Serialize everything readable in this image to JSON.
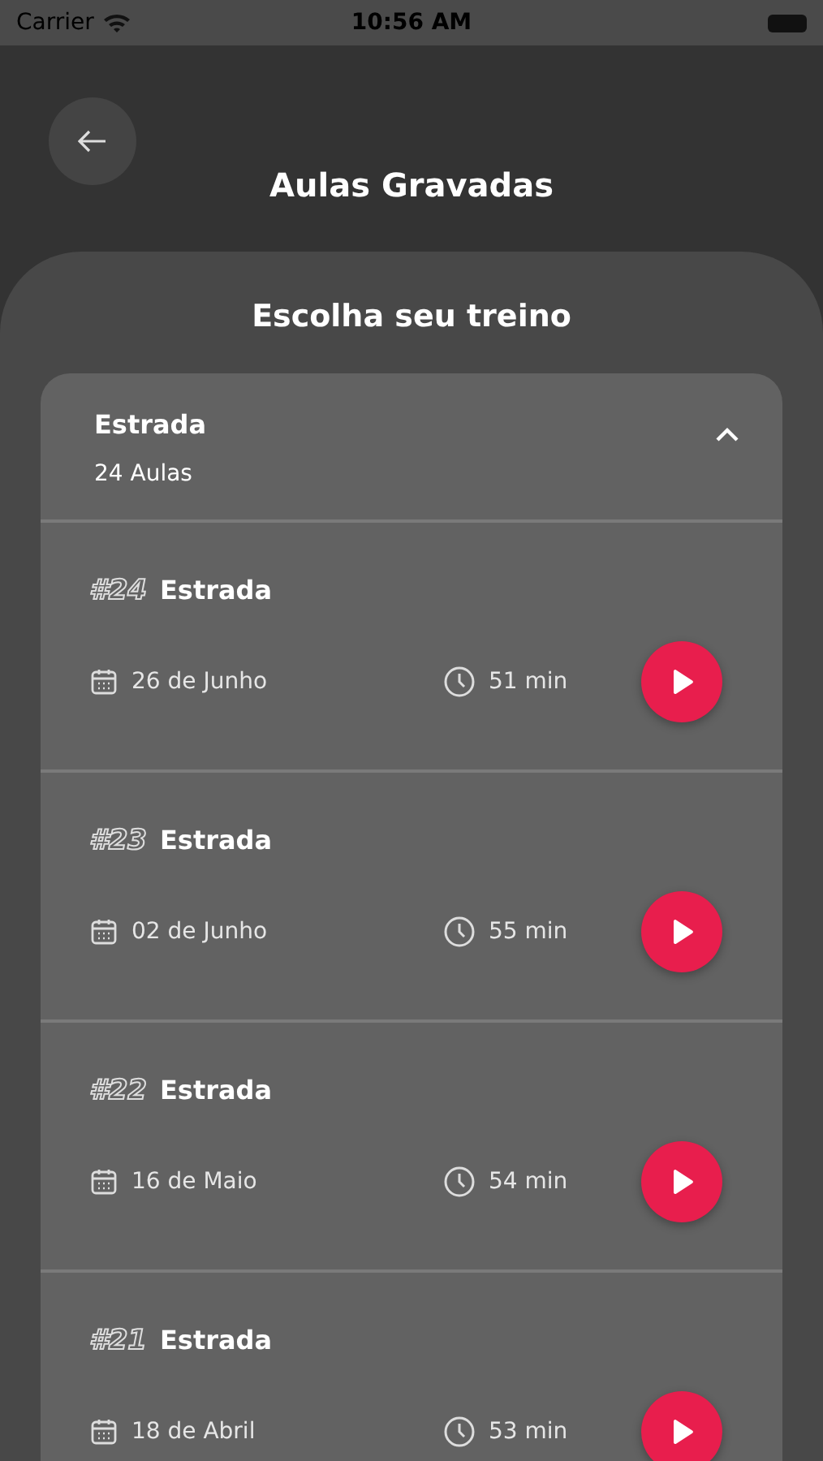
{
  "status_bar": {
    "carrier": "Carrier",
    "time": "10:56 AM"
  },
  "header": {
    "title": "Aulas Gravadas"
  },
  "panel": {
    "title": "Escolha seu treino",
    "group": {
      "title": "Estrada",
      "count": "24 Aulas",
      "expanded": true,
      "lessons": [
        {
          "number": "#24",
          "title": "Estrada",
          "date": "26 de Junho",
          "duration": "51 min"
        },
        {
          "number": "#23",
          "title": "Estrada",
          "date": "02 de Junho",
          "duration": "55 min"
        },
        {
          "number": "#22",
          "title": "Estrada",
          "date": "16 de Maio",
          "duration": "54 min"
        },
        {
          "number": "#21",
          "title": "Estrada",
          "date": "18 de Abril",
          "duration": "53 min"
        }
      ]
    }
  }
}
